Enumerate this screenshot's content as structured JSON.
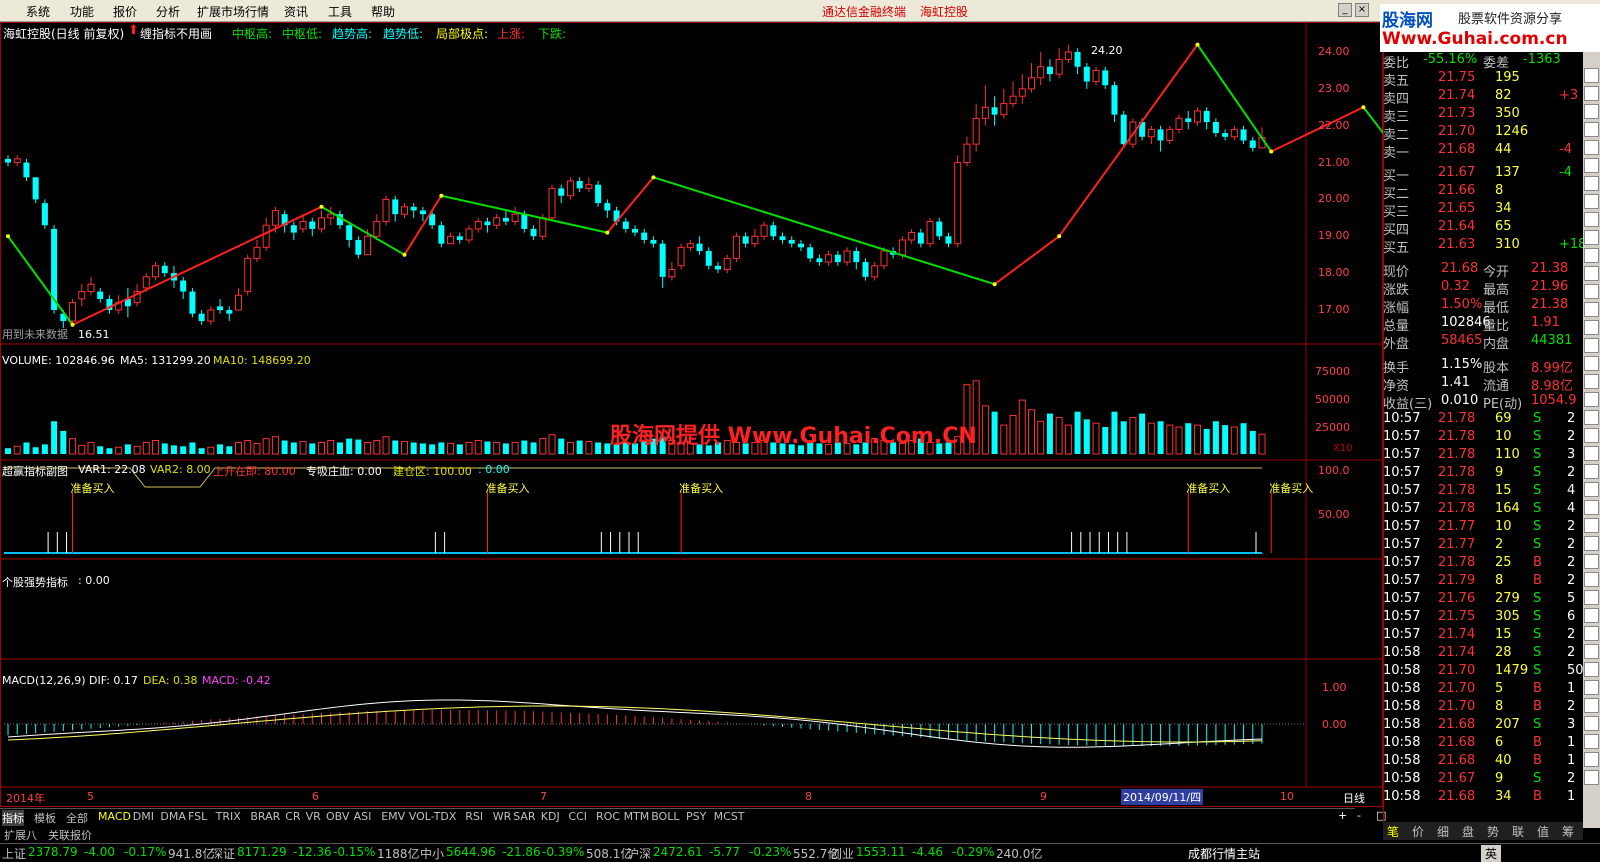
{
  "menu": {
    "items": [
      "系统",
      "功能",
      "报价",
      "分析",
      "扩展市场行情",
      "资讯",
      "工具",
      "帮助"
    ],
    "links": [
      "通达信金融终端",
      "海虹控股"
    ]
  },
  "brand": {
    "logo": "股海网",
    "slogan": "股票软件资源分享",
    "url": "Www.Guhai.com.cn"
  },
  "watermark": "股海网提供 Www.Guhai.Com.CN",
  "main_chart": {
    "title": "海虹控股(日线 前复权)",
    "note": "缠指标不用画",
    "legend": [
      {
        "t": "中枢高:",
        "c": "#00e000"
      },
      {
        "t": "中枢低:",
        "c": "#00e000"
      },
      {
        "t": "趋势高:",
        "c": "#00ffff"
      },
      {
        "t": "趋势低:",
        "c": "#00ffff"
      },
      {
        "t": "局部极点:",
        "c": "#ffff00"
      },
      {
        "t": "上涨:",
        "c": "#ff3030"
      },
      {
        "t": "下跌:",
        "c": "#00e000"
      }
    ],
    "low_label": "16.51",
    "high_label": "24.20",
    "future_note": "用到未来数据",
    "y_ticks": [
      "24.00",
      "23.00",
      "22.00",
      "21.00",
      "20.00",
      "19.00",
      "18.00",
      "17.00"
    ],
    "candles": [
      [
        21.1,
        21.0,
        21.2,
        20.9
      ],
      [
        21.0,
        21.1,
        21.2,
        20.9
      ],
      [
        21.0,
        20.6,
        21.1,
        20.5
      ],
      [
        20.6,
        20.0,
        20.6,
        19.9
      ],
      [
        19.9,
        19.3,
        20.0,
        19.2
      ],
      [
        19.2,
        17.0,
        19.3,
        16.9
      ],
      [
        16.9,
        16.7,
        17.0,
        16.51
      ],
      [
        16.7,
        17.2,
        17.3,
        16.6
      ],
      [
        17.3,
        17.5,
        17.7,
        17.1
      ],
      [
        17.5,
        17.7,
        17.9,
        17.4
      ],
      [
        17.5,
        17.3,
        17.6,
        17.2
      ],
      [
        17.3,
        17.0,
        17.4,
        16.9
      ],
      [
        17.0,
        17.2,
        17.4,
        16.9
      ],
      [
        17.3,
        17.1,
        17.6,
        16.8
      ],
      [
        17.2,
        17.5,
        17.7,
        17.1
      ],
      [
        17.6,
        17.9,
        18.0,
        17.5
      ],
      [
        17.9,
        18.2,
        18.3,
        17.8
      ],
      [
        18.2,
        18.0,
        18.3,
        17.9
      ],
      [
        18.0,
        17.8,
        18.2,
        17.6
      ],
      [
        17.8,
        17.5,
        17.9,
        17.3
      ],
      [
        17.5,
        16.9,
        17.6,
        16.8
      ],
      [
        16.9,
        16.7,
        17.0,
        16.6
      ],
      [
        16.7,
        17.0,
        17.1,
        16.6
      ],
      [
        17.1,
        17.0,
        17.3,
        16.9
      ],
      [
        17.0,
        16.9,
        17.1,
        16.7
      ],
      [
        17.0,
        17.4,
        17.6,
        17.0
      ],
      [
        17.5,
        18.4,
        18.5,
        17.4
      ],
      [
        18.4,
        18.7,
        18.9,
        18.3
      ],
      [
        18.7,
        19.3,
        19.5,
        18.6
      ],
      [
        19.3,
        19.7,
        19.8,
        19.1
      ],
      [
        19.6,
        19.3,
        19.7,
        19.1
      ],
      [
        19.3,
        19.1,
        19.4,
        18.9
      ],
      [
        19.2,
        19.4,
        19.6,
        19.1
      ],
      [
        19.4,
        19.2,
        19.5,
        19.0
      ],
      [
        19.2,
        19.5,
        19.7,
        19.1
      ],
      [
        19.5,
        19.6,
        19.8,
        19.3
      ],
      [
        19.6,
        19.3,
        19.7,
        19.2
      ],
      [
        19.3,
        18.9,
        19.4,
        18.7
      ],
      [
        18.9,
        18.5,
        19.0,
        18.4
      ],
      [
        18.5,
        19.0,
        19.2,
        18.5
      ],
      [
        19.0,
        19.4,
        19.6,
        18.9
      ],
      [
        19.4,
        20.0,
        20.1,
        19.3
      ],
      [
        20.0,
        19.6,
        20.1,
        19.4
      ],
      [
        19.6,
        19.8,
        19.9,
        19.5
      ],
      [
        19.8,
        19.7,
        19.9,
        19.5
      ],
      [
        19.7,
        19.6,
        19.8,
        19.4
      ],
      [
        19.6,
        19.3,
        19.7,
        19.2
      ],
      [
        19.3,
        18.8,
        19.4,
        18.7
      ],
      [
        18.8,
        19.0,
        19.1,
        18.8
      ],
      [
        19.0,
        18.9,
        19.1,
        18.8
      ],
      [
        18.9,
        19.2,
        19.3,
        18.8
      ],
      [
        19.2,
        19.4,
        19.5,
        19.1
      ],
      [
        19.4,
        19.3,
        19.5,
        19.1
      ],
      [
        19.3,
        19.5,
        19.6,
        19.2
      ],
      [
        19.5,
        19.4,
        19.7,
        19.3
      ],
      [
        19.4,
        19.6,
        19.8,
        19.3
      ],
      [
        19.6,
        19.2,
        19.7,
        19.1
      ],
      [
        19.2,
        19.0,
        19.3,
        18.9
      ],
      [
        19.0,
        19.5,
        19.6,
        18.9
      ],
      [
        19.5,
        20.3,
        20.4,
        19.4
      ],
      [
        20.3,
        20.1,
        20.4,
        19.9
      ],
      [
        20.1,
        20.5,
        20.6,
        20.0
      ],
      [
        20.5,
        20.3,
        20.6,
        20.2
      ],
      [
        20.3,
        20.4,
        20.6,
        20.2
      ],
      [
        20.4,
        19.9,
        20.5,
        19.8
      ],
      [
        19.9,
        19.7,
        20.0,
        19.5
      ],
      [
        19.7,
        19.4,
        19.8,
        19.3
      ],
      [
        19.4,
        19.2,
        19.5,
        19.1
      ],
      [
        19.2,
        19.1,
        19.3,
        19.0
      ],
      [
        19.1,
        18.9,
        19.2,
        18.8
      ],
      [
        18.9,
        18.8,
        19.0,
        18.7
      ],
      [
        18.8,
        17.9,
        18.9,
        17.6
      ],
      [
        17.9,
        18.1,
        18.3,
        17.8
      ],
      [
        18.2,
        18.7,
        18.8,
        18.1
      ],
      [
        18.7,
        18.8,
        18.9,
        18.6
      ],
      [
        18.8,
        18.6,
        19.0,
        18.5
      ],
      [
        18.6,
        18.2,
        18.7,
        18.1
      ],
      [
        18.2,
        18.1,
        18.3,
        18.0
      ],
      [
        18.1,
        18.4,
        18.5,
        18.0
      ],
      [
        18.4,
        19.0,
        19.1,
        18.3
      ],
      [
        19.0,
        18.8,
        19.1,
        18.7
      ],
      [
        18.8,
        19.0,
        19.2,
        18.7
      ],
      [
        19.0,
        19.3,
        19.4,
        18.9
      ],
      [
        19.3,
        19.0,
        19.4,
        18.9
      ],
      [
        19.0,
        18.9,
        19.1,
        18.8
      ],
      [
        18.9,
        18.8,
        19.0,
        18.7
      ],
      [
        18.8,
        18.7,
        18.9,
        18.6
      ],
      [
        18.7,
        18.4,
        18.8,
        18.3
      ],
      [
        18.4,
        18.3,
        18.5,
        18.2
      ],
      [
        18.3,
        18.5,
        18.6,
        18.2
      ],
      [
        18.5,
        18.3,
        18.6,
        18.2
      ],
      [
        18.3,
        18.6,
        18.7,
        18.2
      ],
      [
        18.6,
        18.3,
        18.7,
        18.1
      ],
      [
        18.3,
        17.9,
        18.4,
        17.8
      ],
      [
        17.9,
        18.2,
        18.3,
        17.8
      ],
      [
        18.2,
        18.6,
        18.7,
        18.1
      ],
      [
        18.6,
        18.5,
        18.7,
        18.4
      ],
      [
        18.5,
        18.9,
        19.0,
        18.4
      ],
      [
        18.9,
        19.1,
        19.2,
        18.8
      ],
      [
        19.1,
        18.8,
        19.2,
        18.7
      ],
      [
        18.8,
        19.4,
        19.5,
        18.7
      ],
      [
        19.4,
        19.0,
        19.5,
        18.9
      ],
      [
        19.0,
        18.8,
        19.1,
        18.7
      ],
      [
        18.8,
        21.0,
        21.2,
        18.7
      ],
      [
        21.0,
        21.5,
        21.7,
        20.9
      ],
      [
        21.5,
        22.2,
        22.6,
        21.3
      ],
      [
        22.2,
        22.5,
        23.1,
        22.0
      ],
      [
        22.5,
        22.3,
        22.8,
        22.0
      ],
      [
        22.3,
        22.6,
        23.0,
        22.2
      ],
      [
        22.6,
        22.8,
        23.2,
        22.5
      ],
      [
        22.8,
        23.0,
        23.4,
        22.6
      ],
      [
        23.0,
        23.3,
        23.7,
        22.9
      ],
      [
        23.3,
        23.6,
        24.0,
        23.1
      ],
      [
        23.6,
        23.4,
        23.8,
        23.2
      ],
      [
        23.4,
        23.8,
        24.1,
        23.3
      ],
      [
        23.8,
        24.0,
        24.2,
        23.7
      ],
      [
        24.0,
        23.6,
        24.1,
        23.4
      ],
      [
        23.6,
        23.2,
        23.7,
        23.0
      ],
      [
        23.2,
        23.5,
        23.6,
        23.1
      ],
      [
        23.5,
        23.1,
        23.6,
        23.0
      ],
      [
        23.1,
        22.3,
        23.2,
        22.1
      ],
      [
        22.3,
        21.5,
        22.4,
        21.4
      ],
      [
        21.5,
        22.1,
        22.2,
        21.4
      ],
      [
        22.1,
        21.7,
        22.2,
        21.6
      ],
      [
        21.7,
        21.9,
        22.0,
        21.5
      ],
      [
        21.9,
        21.6,
        22.0,
        21.3
      ],
      [
        21.6,
        21.9,
        22.0,
        21.5
      ],
      [
        21.9,
        22.2,
        22.3,
        21.8
      ],
      [
        22.2,
        22.1,
        22.4,
        21.9
      ],
      [
        22.1,
        22.4,
        22.5,
        22.0
      ],
      [
        22.4,
        22.1,
        22.5,
        21.9
      ],
      [
        22.1,
        21.8,
        22.2,
        21.7
      ],
      [
        21.8,
        21.7,
        21.9,
        21.6
      ],
      [
        21.7,
        21.9,
        22.0,
        21.6
      ],
      [
        21.9,
        21.6,
        22.0,
        21.5
      ],
      [
        21.6,
        21.4,
        21.7,
        21.3
      ],
      [
        21.4,
        21.68,
        21.96,
        21.38
      ]
    ],
    "trend_points": [
      [
        0,
        19.0
      ],
      [
        7,
        16.6
      ],
      [
        34,
        19.8
      ],
      [
        43,
        18.5
      ],
      [
        47,
        20.1
      ],
      [
        65,
        19.1
      ],
      [
        70,
        20.6
      ],
      [
        107,
        17.7
      ],
      [
        114,
        19.0
      ],
      [
        129,
        24.2
      ],
      [
        137,
        21.3
      ],
      [
        147,
        22.5
      ],
      [
        151,
        21.2
      ]
    ],
    "trend_colors": [
      "#00e000",
      "#ff2020",
      "#00e000",
      "#ff2020",
      "#00e000",
      "#ff2020",
      "#00e000",
      "#ff2020",
      "#ff2020",
      "#00e000",
      "#ff2020",
      "#00e000"
    ]
  },
  "volume": {
    "label": "VOLUME: 102846.96",
    "ma5": "MA5: 131299.20",
    "ma10": "MA10: 148699.20",
    "y_ticks": [
      "75000",
      "50000",
      "25000"
    ],
    "unit": "X10",
    "values": [
      30,
      40,
      60,
      35,
      50,
      170,
      120,
      80,
      45,
      60,
      40,
      30,
      35,
      50,
      40,
      60,
      70,
      55,
      45,
      40,
      60,
      30,
      35,
      50,
      40,
      60,
      70,
      55,
      80,
      90,
      70,
      60,
      65,
      55,
      60,
      70,
      60,
      80,
      75,
      60,
      70,
      90,
      70,
      65,
      60,
      55,
      50,
      60,
      55,
      50,
      60,
      70,
      65,
      60,
      55,
      60,
      70,
      60,
      80,
      100,
      80,
      60,
      70,
      65,
      60,
      55,
      50,
      60,
      55,
      70,
      80,
      90,
      70,
      60,
      55,
      50,
      45,
      60,
      70,
      60,
      55,
      60,
      70,
      60,
      55,
      50,
      45,
      60,
      55,
      50,
      60,
      55,
      50,
      60,
      80,
      70,
      60,
      55,
      70,
      80,
      60,
      55,
      60,
      90,
      360,
      380,
      250,
      220,
      150,
      200,
      280,
      230,
      170,
      210,
      190,
      150,
      220,
      180,
      160,
      140,
      220,
      170,
      190,
      210,
      160,
      170,
      150,
      140,
      160,
      150,
      130,
      170,
      150,
      140,
      160,
      120,
      103
    ]
  },
  "indicator1": {
    "title": "超赢指标副图",
    "var1": "VAR1: 22.08",
    "var2": "VAR2: 8.00",
    "rise": "上升在即: 80.00",
    "absorb": "专吸庄血: 0.00",
    "build": "建仓区: 100.00",
    "build2": ": 0.00",
    "y_ticks": [
      "100.0",
      "50.00"
    ],
    "signal": "准备买入"
  },
  "indicator2": {
    "title": "个股强势指标",
    "value": ": 0.00"
  },
  "macd": {
    "title": "MACD(12,26,9)",
    "dif": "DIF: 0.17",
    "dea": "DEA: 0.38",
    "macd": "MACD: -0.42",
    "y_ticks": [
      "1.00",
      "0.00"
    ]
  },
  "x_axis": {
    "labels": [
      "2014年",
      "5",
      "6",
      "7",
      "8",
      "9",
      "10"
    ],
    "cursor_date": "2014/09/11/四",
    "period": "日线"
  },
  "tabs": [
    "指标",
    "模板",
    "全部",
    "MACD",
    "DMI",
    "DMA",
    "FSL",
    "TRIX",
    "BRAR",
    "CR",
    "VR",
    "OBV",
    "ASI",
    "EMV",
    "VOL-TDX",
    "RSI",
    "WR",
    "SAR",
    "KDJ",
    "CCI",
    "ROC",
    "MTM",
    "BOLL",
    "PSY",
    "MCST"
  ],
  "subtabs": [
    "扩展八",
    "关联报价"
  ],
  "quote": {
    "weibi": [
      "委比",
      "-55.16%",
      "委差",
      "-1363"
    ],
    "asks": [
      [
        "卖五",
        "21.75",
        "195",
        ""
      ],
      [
        "卖四",
        "21.74",
        "82",
        "+3"
      ],
      [
        "卖三",
        "21.73",
        "350",
        ""
      ],
      [
        "卖二",
        "21.70",
        "1246",
        ""
      ],
      [
        "卖一",
        "21.68",
        "44",
        "-4"
      ]
    ],
    "bids": [
      [
        "买一",
        "21.67",
        "137",
        "-4"
      ],
      [
        "买二",
        "21.66",
        "8",
        ""
      ],
      [
        "买三",
        "21.65",
        "34",
        ""
      ],
      [
        "买四",
        "21.64",
        "65",
        ""
      ],
      [
        "买五",
        "21.63",
        "310",
        "+18"
      ]
    ],
    "stats": [
      [
        "现价",
        "21.68",
        "今开",
        "21.38"
      ],
      [
        "涨跌",
        "0.32",
        "最高",
        "21.96"
      ],
      [
        "涨幅",
        "1.50%",
        "最低",
        "21.38"
      ],
      [
        "总量",
        "102846",
        "量比",
        "1.91"
      ],
      [
        "外盘",
        "58465",
        "内盘",
        "44381"
      ],
      [
        "换手",
        "1.15%",
        "股本",
        "8.99亿"
      ],
      [
        "净资",
        "1.41",
        "流通",
        "8.98亿"
      ],
      [
        "收益(三)",
        "0.010",
        "PE(动)",
        "1054.9"
      ]
    ],
    "ticks": [
      [
        "10:57",
        "21.78",
        "69",
        "S",
        "2"
      ],
      [
        "10:57",
        "21.78",
        "10",
        "S",
        "2"
      ],
      [
        "10:57",
        "21.78",
        "110",
        "S",
        "3"
      ],
      [
        "10:57",
        "21.78",
        "9",
        "S",
        "2"
      ],
      [
        "10:57",
        "21.78",
        "15",
        "S",
        "4"
      ],
      [
        "10:57",
        "21.78",
        "164",
        "S",
        "4"
      ],
      [
        "10:57",
        "21.77",
        "10",
        "S",
        "2"
      ],
      [
        "10:57",
        "21.77",
        "2",
        "S",
        "2"
      ],
      [
        "10:57",
        "21.78",
        "25",
        "B",
        "2"
      ],
      [
        "10:57",
        "21.79",
        "8",
        "B",
        "2"
      ],
      [
        "10:57",
        "21.76",
        "279",
        "S",
        "5"
      ],
      [
        "10:57",
        "21.75",
        "305",
        "S",
        "6"
      ],
      [
        "10:57",
        "21.74",
        "15",
        "S",
        "2"
      ],
      [
        "10:58",
        "21.74",
        "28",
        "S",
        "2"
      ],
      [
        "10:58",
        "21.70",
        "1479",
        "S",
        "50"
      ],
      [
        "10:58",
        "21.70",
        "5",
        "B",
        "1"
      ],
      [
        "10:58",
        "21.70",
        "8",
        "B",
        "2"
      ],
      [
        "10:58",
        "21.68",
        "207",
        "S",
        "3"
      ],
      [
        "10:58",
        "21.68",
        "6",
        "B",
        "1"
      ],
      [
        "10:58",
        "21.68",
        "40",
        "B",
        "1"
      ],
      [
        "10:58",
        "21.67",
        "9",
        "S",
        "2"
      ],
      [
        "10:58",
        "21.68",
        "34",
        "B",
        "1"
      ]
    ],
    "bottom_tabs": [
      "笔",
      "价",
      "细",
      "盘",
      "势",
      "联",
      "值",
      "筹"
    ]
  },
  "status": {
    "items": [
      {
        "name": "上证",
        "val": "2378.79",
        "chg": "-4.00",
        "pct": "-0.17%",
        "amt": "941.8亿"
      },
      {
        "name": "深证",
        "val": "8171.29",
        "chg": "-12.36",
        "pct": "-0.15%",
        "amt": "1188亿"
      },
      {
        "name": "中小",
        "val": "5644.96",
        "chg": "-21.86",
        "pct": "-0.39%",
        "amt": "508.1亿"
      },
      {
        "name": "沪深",
        "val": "2472.61",
        "chg": "-5.77",
        "pct": "-0.23%",
        "amt": "552.7亿"
      },
      {
        "name": "创业",
        "val": "1553.11",
        "chg": "-4.46",
        "pct": "-0.29%",
        "amt": "240.0亿"
      }
    ],
    "station": "成都行情主站",
    "ime": "英"
  }
}
